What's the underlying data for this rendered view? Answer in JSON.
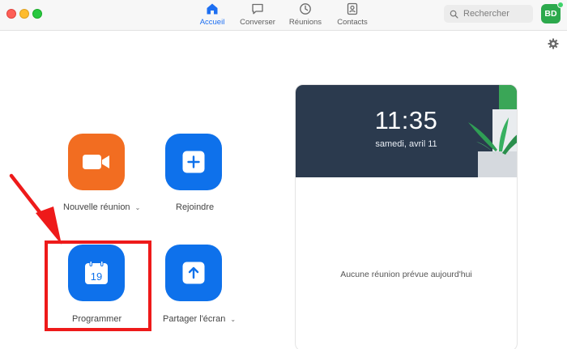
{
  "nav": {
    "home": "Accueil",
    "chat": "Converser",
    "meetings": "Réunions",
    "contacts": "Contacts"
  },
  "search": {
    "placeholder": "Rechercher"
  },
  "user": {
    "initials": "BD"
  },
  "actions": {
    "new_meeting": "Nouvelle réunion",
    "join": "Rejoindre",
    "schedule": "Programmer",
    "schedule_day": "19",
    "share_screen": "Partager l'écran"
  },
  "panel": {
    "time": "11:35",
    "date": "samedi, avril 11",
    "empty": "Aucune réunion prévue aujourd'hui"
  },
  "colors": {
    "accent": "#0e71eb",
    "new_meeting": "#f26d21",
    "highlight": "#ee1a1a",
    "avatar": "#2ca94c"
  }
}
